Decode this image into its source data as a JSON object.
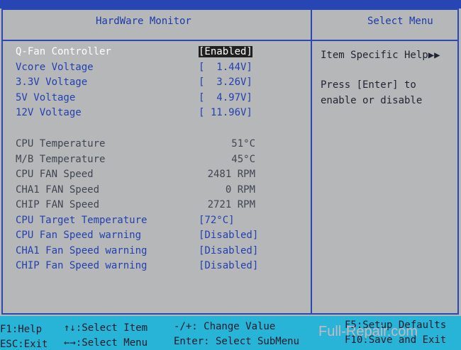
{
  "header": {
    "title": "HardWare Monitor",
    "right_title": "Select Menu"
  },
  "items": [
    {
      "label": "Q-Fan Controller",
      "value": "[Enabled]"
    },
    {
      "label": "Vcore Voltage",
      "value": "[  1.44V]"
    },
    {
      "label": "3.3V Voltage",
      "value": "[  3.26V]"
    },
    {
      "label": "5V Voltage",
      "value": "[  4.97V]"
    },
    {
      "label": "12V Voltage",
      "value": "[ 11.96V]"
    }
  ],
  "readings": [
    {
      "label": "CPU Temperature",
      "value": "51°C"
    },
    {
      "label": "M/B Temperature",
      "value": "45°C"
    },
    {
      "label": "CPU FAN Speed",
      "value": "2481 RPM"
    },
    {
      "label": "CHA1 FAN Speed",
      "value": "0 RPM"
    },
    {
      "label": "CHIP FAN Speed",
      "value": "2721 RPM"
    }
  ],
  "settings": [
    {
      "label": "CPU Target Temperature",
      "value": "[72°C]"
    },
    {
      "label": "CPU Fan Speed warning",
      "value": "[Disabled]"
    },
    {
      "label": "CHA1 Fan Speed warning",
      "value": "[Disabled]"
    },
    {
      "label": "CHIP Fan Speed warning",
      "value": "[Disabled]"
    }
  ],
  "help": {
    "title": "Item Specific Help▶▶",
    "line1": "Press [Enter] to",
    "line2": "enable or disable"
  },
  "footer": {
    "f1": "F1:Help",
    "esc": "ESC:Exit",
    "select_item": "↑↓:Select Item",
    "select_menu": "←→:Select Menu",
    "change_value": "-/+: Change Value",
    "submenu": "Enter: Select SubMenu",
    "f5": "F5:Setup Defaults",
    "f10": "F10:Save and Exit"
  },
  "watermark": "Full-Repair.com",
  "colors": {
    "background": "#b6b7b9",
    "frame": "#2b49b0",
    "footer": "#27b4d6",
    "selected": "#202020"
  }
}
